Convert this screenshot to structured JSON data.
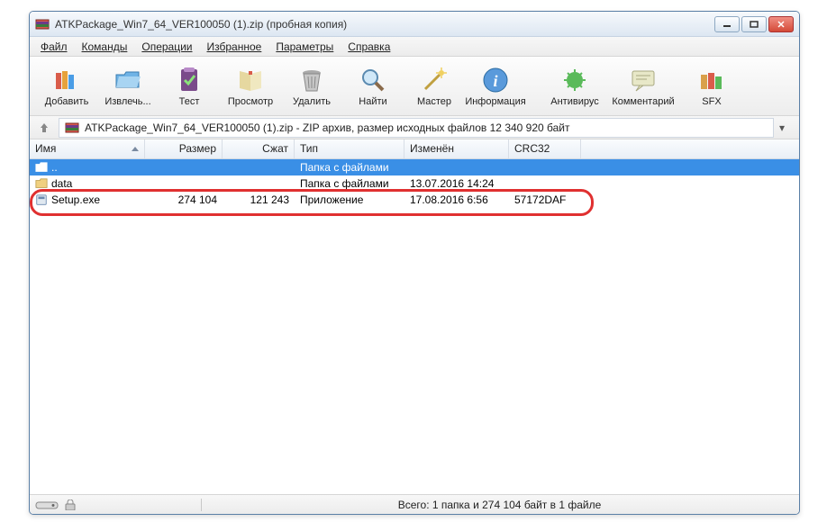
{
  "title": "ATKPackage_Win7_64_VER100050 (1).zip (пробная копия)",
  "menu": {
    "file": "Файл",
    "commands": "Команды",
    "operations": "Операции",
    "favorites": "Избранное",
    "options": "Параметры",
    "help": "Справка"
  },
  "toolbar": {
    "add": "Добавить",
    "extract": "Извлечь...",
    "test": "Тест",
    "view": "Просмотр",
    "delete": "Удалить",
    "find": "Найти",
    "wizard": "Мастер",
    "info": "Информация",
    "av": "Антивирус",
    "comment": "Комментарий",
    "sfx": "SFX"
  },
  "address": {
    "text": "ATKPackage_Win7_64_VER100050 (1).zip - ZIP архив, размер исходных файлов 12 340 920 байт"
  },
  "columns": {
    "name": "Имя",
    "size": "Размер",
    "packed": "Сжат",
    "type": "Тип",
    "modified": "Изменён",
    "crc": "CRC32"
  },
  "rows": [
    {
      "icon": "folder-up",
      "name": "..",
      "size": "",
      "packed": "",
      "type": "Папка с файлами",
      "modified": "",
      "crc": "",
      "selected": true
    },
    {
      "icon": "folder",
      "name": "data",
      "size": "",
      "packed": "",
      "type": "Папка с файлами",
      "modified": "13.07.2016 14:24",
      "crc": "",
      "selected": false
    },
    {
      "icon": "exe",
      "name": "Setup.exe",
      "size": "274 104",
      "packed": "121 243",
      "type": "Приложение",
      "modified": "17.08.2016 6:56",
      "crc": "57172DAF",
      "selected": false
    }
  ],
  "status": {
    "total": "Всего: 1 папка и 274 104 байт в 1 файле"
  }
}
